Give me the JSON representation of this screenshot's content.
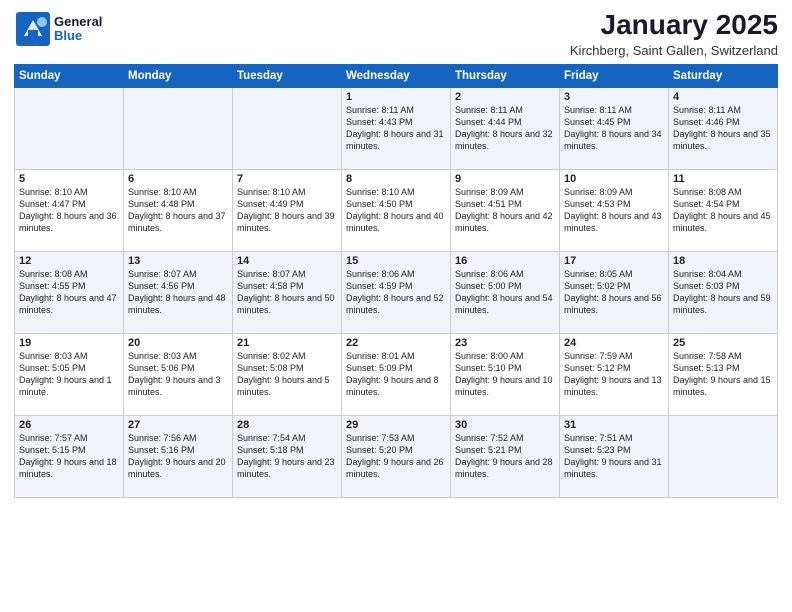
{
  "header": {
    "logo_general": "General",
    "logo_blue": "Blue",
    "month": "January 2025",
    "location": "Kirchberg, Saint Gallen, Switzerland"
  },
  "days_of_week": [
    "Sunday",
    "Monday",
    "Tuesday",
    "Wednesday",
    "Thursday",
    "Friday",
    "Saturday"
  ],
  "weeks": [
    [
      {
        "day": "",
        "info": ""
      },
      {
        "day": "",
        "info": ""
      },
      {
        "day": "",
        "info": ""
      },
      {
        "day": "1",
        "info": "Sunrise: 8:11 AM\nSunset: 4:43 PM\nDaylight: 8 hours and 31 minutes."
      },
      {
        "day": "2",
        "info": "Sunrise: 8:11 AM\nSunset: 4:44 PM\nDaylight: 8 hours and 32 minutes."
      },
      {
        "day": "3",
        "info": "Sunrise: 8:11 AM\nSunset: 4:45 PM\nDaylight: 8 hours and 34 minutes."
      },
      {
        "day": "4",
        "info": "Sunrise: 8:11 AM\nSunset: 4:46 PM\nDaylight: 8 hours and 35 minutes."
      }
    ],
    [
      {
        "day": "5",
        "info": "Sunrise: 8:10 AM\nSunset: 4:47 PM\nDaylight: 8 hours and 36 minutes."
      },
      {
        "day": "6",
        "info": "Sunrise: 8:10 AM\nSunset: 4:48 PM\nDaylight: 8 hours and 37 minutes."
      },
      {
        "day": "7",
        "info": "Sunrise: 8:10 AM\nSunset: 4:49 PM\nDaylight: 8 hours and 39 minutes."
      },
      {
        "day": "8",
        "info": "Sunrise: 8:10 AM\nSunset: 4:50 PM\nDaylight: 8 hours and 40 minutes."
      },
      {
        "day": "9",
        "info": "Sunrise: 8:09 AM\nSunset: 4:51 PM\nDaylight: 8 hours and 42 minutes."
      },
      {
        "day": "10",
        "info": "Sunrise: 8:09 AM\nSunset: 4:53 PM\nDaylight: 8 hours and 43 minutes."
      },
      {
        "day": "11",
        "info": "Sunrise: 8:08 AM\nSunset: 4:54 PM\nDaylight: 8 hours and 45 minutes."
      }
    ],
    [
      {
        "day": "12",
        "info": "Sunrise: 8:08 AM\nSunset: 4:55 PM\nDaylight: 8 hours and 47 minutes."
      },
      {
        "day": "13",
        "info": "Sunrise: 8:07 AM\nSunset: 4:56 PM\nDaylight: 8 hours and 48 minutes."
      },
      {
        "day": "14",
        "info": "Sunrise: 8:07 AM\nSunset: 4:58 PM\nDaylight: 8 hours and 50 minutes."
      },
      {
        "day": "15",
        "info": "Sunrise: 8:06 AM\nSunset: 4:59 PM\nDaylight: 8 hours and 52 minutes."
      },
      {
        "day": "16",
        "info": "Sunrise: 8:06 AM\nSunset: 5:00 PM\nDaylight: 8 hours and 54 minutes."
      },
      {
        "day": "17",
        "info": "Sunrise: 8:05 AM\nSunset: 5:02 PM\nDaylight: 8 hours and 56 minutes."
      },
      {
        "day": "18",
        "info": "Sunrise: 8:04 AM\nSunset: 5:03 PM\nDaylight: 8 hours and 59 minutes."
      }
    ],
    [
      {
        "day": "19",
        "info": "Sunrise: 8:03 AM\nSunset: 5:05 PM\nDaylight: 9 hours and 1 minute."
      },
      {
        "day": "20",
        "info": "Sunrise: 8:03 AM\nSunset: 5:06 PM\nDaylight: 9 hours and 3 minutes."
      },
      {
        "day": "21",
        "info": "Sunrise: 8:02 AM\nSunset: 5:08 PM\nDaylight: 9 hours and 5 minutes."
      },
      {
        "day": "22",
        "info": "Sunrise: 8:01 AM\nSunset: 5:09 PM\nDaylight: 9 hours and 8 minutes."
      },
      {
        "day": "23",
        "info": "Sunrise: 8:00 AM\nSunset: 5:10 PM\nDaylight: 9 hours and 10 minutes."
      },
      {
        "day": "24",
        "info": "Sunrise: 7:59 AM\nSunset: 5:12 PM\nDaylight: 9 hours and 13 minutes."
      },
      {
        "day": "25",
        "info": "Sunrise: 7:58 AM\nSunset: 5:13 PM\nDaylight: 9 hours and 15 minutes."
      }
    ],
    [
      {
        "day": "26",
        "info": "Sunrise: 7:57 AM\nSunset: 5:15 PM\nDaylight: 9 hours and 18 minutes."
      },
      {
        "day": "27",
        "info": "Sunrise: 7:56 AM\nSunset: 5:16 PM\nDaylight: 9 hours and 20 minutes."
      },
      {
        "day": "28",
        "info": "Sunrise: 7:54 AM\nSunset: 5:18 PM\nDaylight: 9 hours and 23 minutes."
      },
      {
        "day": "29",
        "info": "Sunrise: 7:53 AM\nSunset: 5:20 PM\nDaylight: 9 hours and 26 minutes."
      },
      {
        "day": "30",
        "info": "Sunrise: 7:52 AM\nSunset: 5:21 PM\nDaylight: 9 hours and 28 minutes."
      },
      {
        "day": "31",
        "info": "Sunrise: 7:51 AM\nSunset: 5:23 PM\nDaylight: 9 hours and 31 minutes."
      },
      {
        "day": "",
        "info": ""
      }
    ]
  ]
}
